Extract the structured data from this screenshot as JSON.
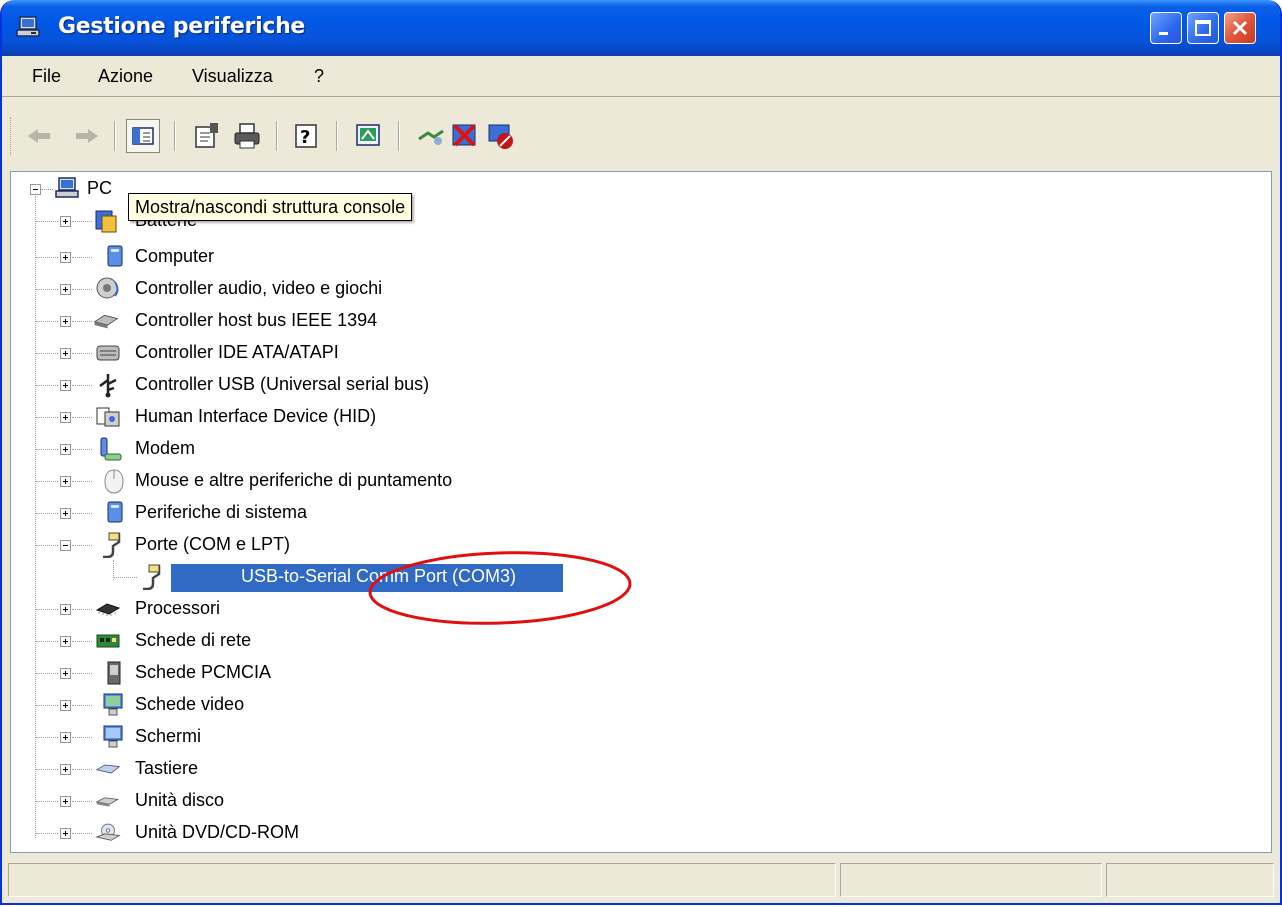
{
  "window": {
    "title": "Gestione periferiche",
    "accent_color": "#0058e6"
  },
  "menu": {
    "items": [
      "File",
      "Azione",
      "Visualizza",
      "?"
    ]
  },
  "toolbar": {
    "icons": [
      "back-arrow-icon",
      "forward-arrow-icon",
      "show-hide-console-tree-icon",
      "properties-icon",
      "print-icon",
      "help-icon",
      "update-driver-icon",
      "scan-hardware-icon",
      "uninstall-icon",
      "disable-icon"
    ]
  },
  "tooltip": {
    "text": "Mostra/nascondi struttura console"
  },
  "tree": {
    "root_label": "PC",
    "items": [
      {
        "label": "Batterie",
        "icon": "battery-icon"
      },
      {
        "label": "Computer",
        "icon": "computer-icon"
      },
      {
        "label": "Controller audio, video e giochi",
        "icon": "audio-icon"
      },
      {
        "label": "Controller host bus IEEE 1394",
        "icon": "ieee1394-icon"
      },
      {
        "label": "Controller IDE ATA/ATAPI",
        "icon": "ide-icon"
      },
      {
        "label": "Controller USB (Universal serial bus)",
        "icon": "usb-icon"
      },
      {
        "label": "Human Interface Device (HID)",
        "icon": "hid-icon"
      },
      {
        "label": "Modem",
        "icon": "modem-icon"
      },
      {
        "label": "Mouse e altre periferiche di puntamento",
        "icon": "mouse-icon"
      },
      {
        "label": "Periferiche di sistema",
        "icon": "system-device-icon"
      },
      {
        "label": "Porte (COM e LPT)",
        "icon": "port-icon"
      },
      {
        "label": "USB-to-Serial Comm Port (COM3)",
        "icon": "serial-port-icon"
      },
      {
        "label": "Processori",
        "icon": "processor-icon"
      },
      {
        "label": "Schede di rete",
        "icon": "network-card-icon"
      },
      {
        "label": "Schede PCMCIA",
        "icon": "pcmcia-icon"
      },
      {
        "label": "Schede video",
        "icon": "display-adapter-icon"
      },
      {
        "label": "Schermi",
        "icon": "monitor-icon"
      },
      {
        "label": "Tastiere",
        "icon": "keyboard-icon"
      },
      {
        "label": "Unità disco",
        "icon": "disk-drive-icon"
      },
      {
        "label": "Unità DVD/CD-ROM",
        "icon": "dvd-icon"
      }
    ],
    "selected": "USB-to-Serial Comm Port (COM3)"
  },
  "annotation": {
    "color": "#e01010"
  }
}
